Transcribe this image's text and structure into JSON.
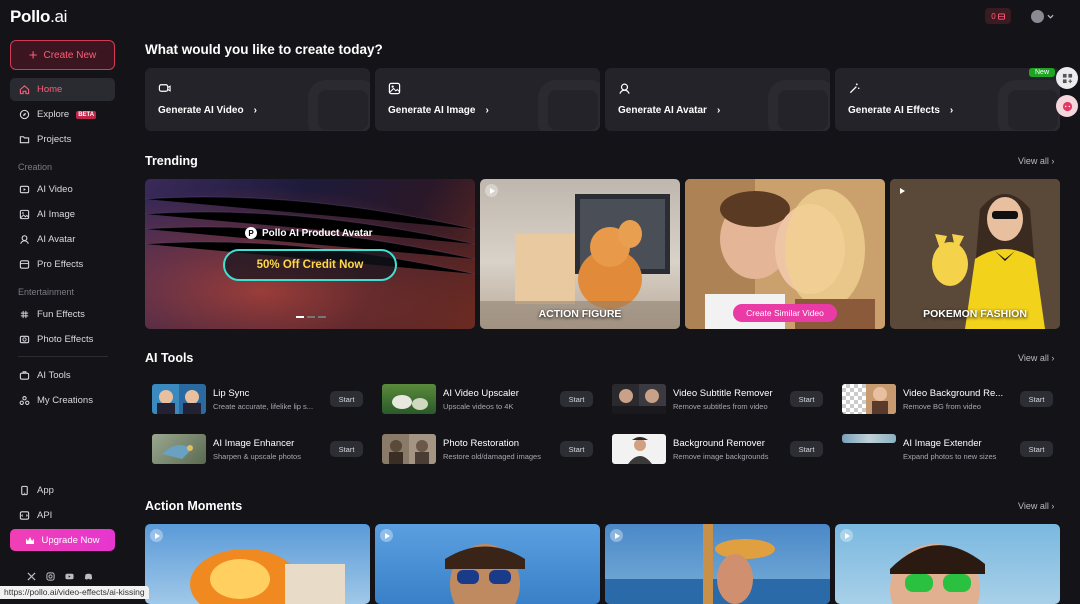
{
  "brand": {
    "logo_main": "Pollo",
    "logo_suffix": ".ai"
  },
  "sidebar": {
    "create_label": "Create New",
    "items": [
      {
        "label": "Home",
        "icon": "home-icon"
      },
      {
        "label": "Explore",
        "badge": "BETA",
        "icon": "compass-icon"
      },
      {
        "label": "Projects",
        "icon": "folder-icon"
      },
      {
        "label": "AI Video",
        "icon": "video-icon"
      },
      {
        "label": "AI Image",
        "icon": "image-icon"
      },
      {
        "label": "AI Avatar",
        "icon": "avatar-icon"
      },
      {
        "label": "Pro Effects",
        "icon": "pro-effects-icon"
      },
      {
        "label": "Fun Effects",
        "icon": "fun-effects-icon"
      },
      {
        "label": "Photo Effects",
        "icon": "photo-effects-icon"
      },
      {
        "label": "AI Tools",
        "icon": "tools-icon"
      },
      {
        "label": "My Creations",
        "icon": "creations-icon"
      },
      {
        "label": "App",
        "icon": "phone-icon"
      },
      {
        "label": "API",
        "icon": "api-icon"
      }
    ],
    "sections": {
      "creation": "Creation",
      "entertainment": "Entertainment"
    },
    "upgrade_label": "Upgrade Now"
  },
  "topbar": {
    "credits": "0"
  },
  "main": {
    "title": "What would you like to create today?",
    "generate_cards": [
      {
        "label": "Generate AI Video"
      },
      {
        "label": "Generate AI Image"
      },
      {
        "label": "Generate AI Avatar"
      },
      {
        "label": "Generate AI Effects",
        "badge": "New"
      }
    ],
    "trending": {
      "title": "Trending",
      "view_all": "View all",
      "banner_title": "Pollo AI Product Avatar",
      "banner_cta": "50% Off Credit Now",
      "items": [
        {
          "caption": "ACTION FIGURE"
        },
        {
          "caption": "Create Similar Video"
        },
        {
          "caption": "POKEMON FASHION"
        }
      ]
    },
    "ai_tools": {
      "title": "AI Tools",
      "view_all": "View all",
      "start_label": "Start",
      "tools": [
        {
          "name": "Lip Sync",
          "desc": "Create accurate, lifelike lip s..."
        },
        {
          "name": "AI Video Upscaler",
          "desc": "Upscale videos to 4K"
        },
        {
          "name": "Video Subtitle Remover",
          "desc": "Remove subtitles from video"
        },
        {
          "name": "Video Background Re...",
          "desc": "Remove BG from video"
        },
        {
          "name": "AI Image Enhancer",
          "desc": "Sharpen & upscale photos"
        },
        {
          "name": "Photo Restoration",
          "desc": "Restore old/damaged images"
        },
        {
          "name": "Background Remover",
          "desc": "Remove image backgrounds"
        },
        {
          "name": "AI Image Extender",
          "desc": "Expand photos to new sizes"
        }
      ]
    },
    "action_moments": {
      "title": "Action Moments",
      "view_all": "View all"
    }
  },
  "status_url": "https://pollo.ai/video-effects/ai-kissing"
}
